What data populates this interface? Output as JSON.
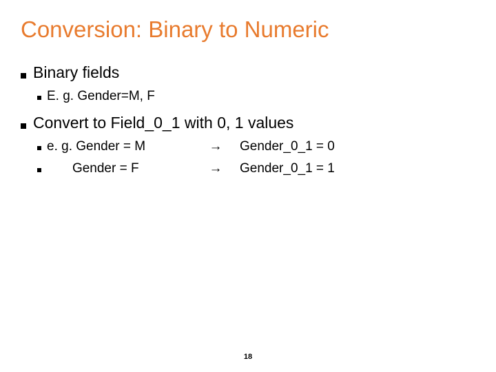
{
  "slide": {
    "title": "Conversion: Binary to Numeric",
    "bullets": {
      "b1": {
        "text": "Binary fields",
        "sub1": "E. g. Gender=M, F"
      },
      "b2": {
        "text": "Convert to Field_0_1 with 0, 1 values",
        "rows": [
          {
            "left": "e. g. Gender = M",
            "arrow": "→",
            "right": "Gender_0_1 = 0"
          },
          {
            "left": "       Gender = F",
            "arrow": "→",
            "right": "Gender_0_1 = 1"
          }
        ]
      }
    },
    "page_number": "18"
  }
}
